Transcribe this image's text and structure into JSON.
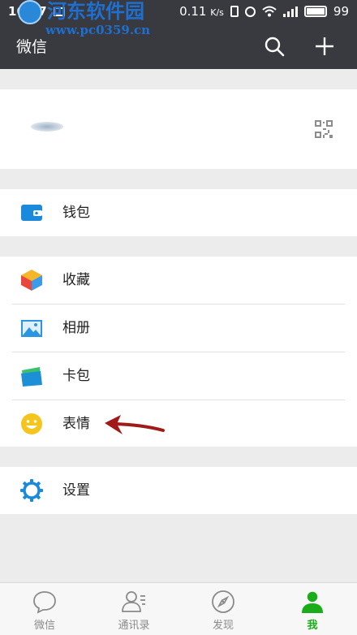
{
  "status_bar": {
    "time": "16:57",
    "speed": "0.11",
    "speed_unit": "K/s",
    "battery": "99"
  },
  "watermark": {
    "name": "河东软件园",
    "url": "www.pc0359.cn"
  },
  "header": {
    "title": "微信"
  },
  "menu": {
    "wallet": "钱包",
    "favorites": "收藏",
    "album": "相册",
    "cards": "卡包",
    "stickers": "表情",
    "settings": "设置"
  },
  "nav": {
    "chats": "微信",
    "contacts": "通讯录",
    "discover": "发现",
    "me": "我"
  },
  "colors": {
    "header_bg": "#393a3f",
    "accent_green": "#1aad19",
    "annotation_arrow": "#a11a1a"
  }
}
